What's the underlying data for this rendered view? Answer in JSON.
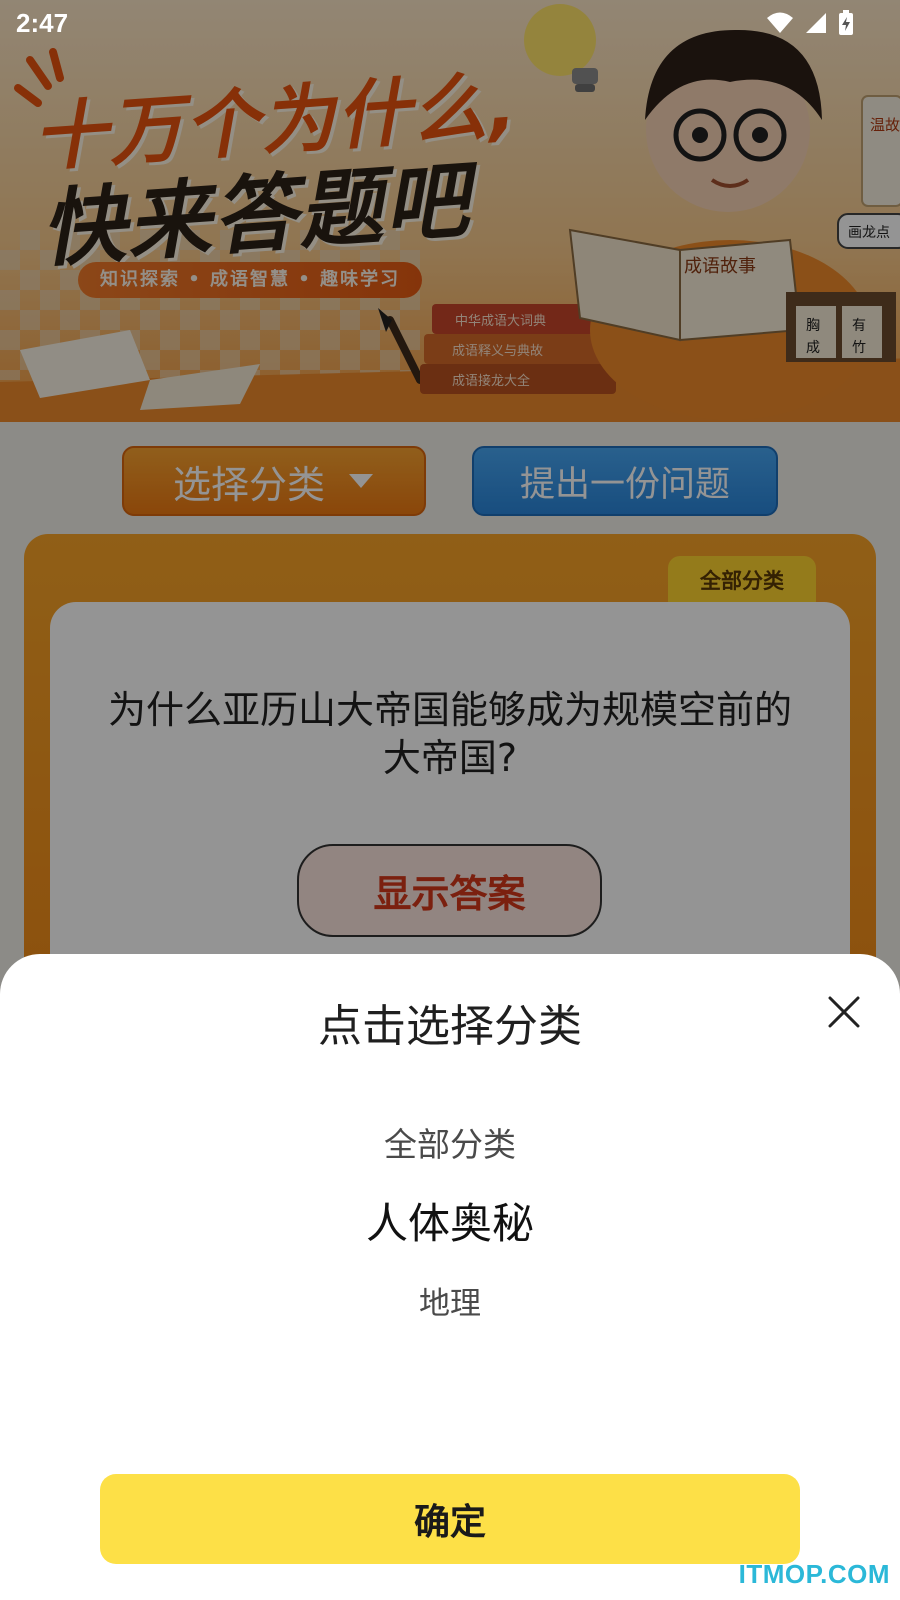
{
  "status_bar": {
    "time": "2:47",
    "icons": [
      "wifi-icon",
      "cell-signal-icon",
      "battery-charging-icon"
    ]
  },
  "hero": {
    "title_line1": "十万个为什么,",
    "title_line2": "快来答题吧",
    "tagline": "知识探索 • 成语智慧 • 趣味学习",
    "book_title": "成语故事",
    "book_spines": [
      "中华成语大词典",
      "成语释义与典故",
      "成语接龙大全"
    ],
    "scroll_text": "温故知新",
    "tag_text": "画龙点",
    "plaque_text": [
      "胸",
      "有",
      "成",
      "竹"
    ]
  },
  "main": {
    "category_button_label": "选择分类",
    "ask_button_label": "提出一份问题",
    "category_badge": "全部分类",
    "question": "为什么亚历山大帝国能够成为规模空前的大帝国?",
    "show_answer_label": "显示答案"
  },
  "sheet": {
    "title": "点击选择分类",
    "picker": {
      "previous": "全部分类",
      "selected": "人体奥秘",
      "next": "地理"
    },
    "confirm_label": "确定"
  },
  "watermark": "ITMOP.COM",
  "colors": {
    "accent_orange": "#ee7a12",
    "accent_blue": "#2a86db",
    "confirm_yellow": "#fde047",
    "answer_red": "#d4381a"
  }
}
